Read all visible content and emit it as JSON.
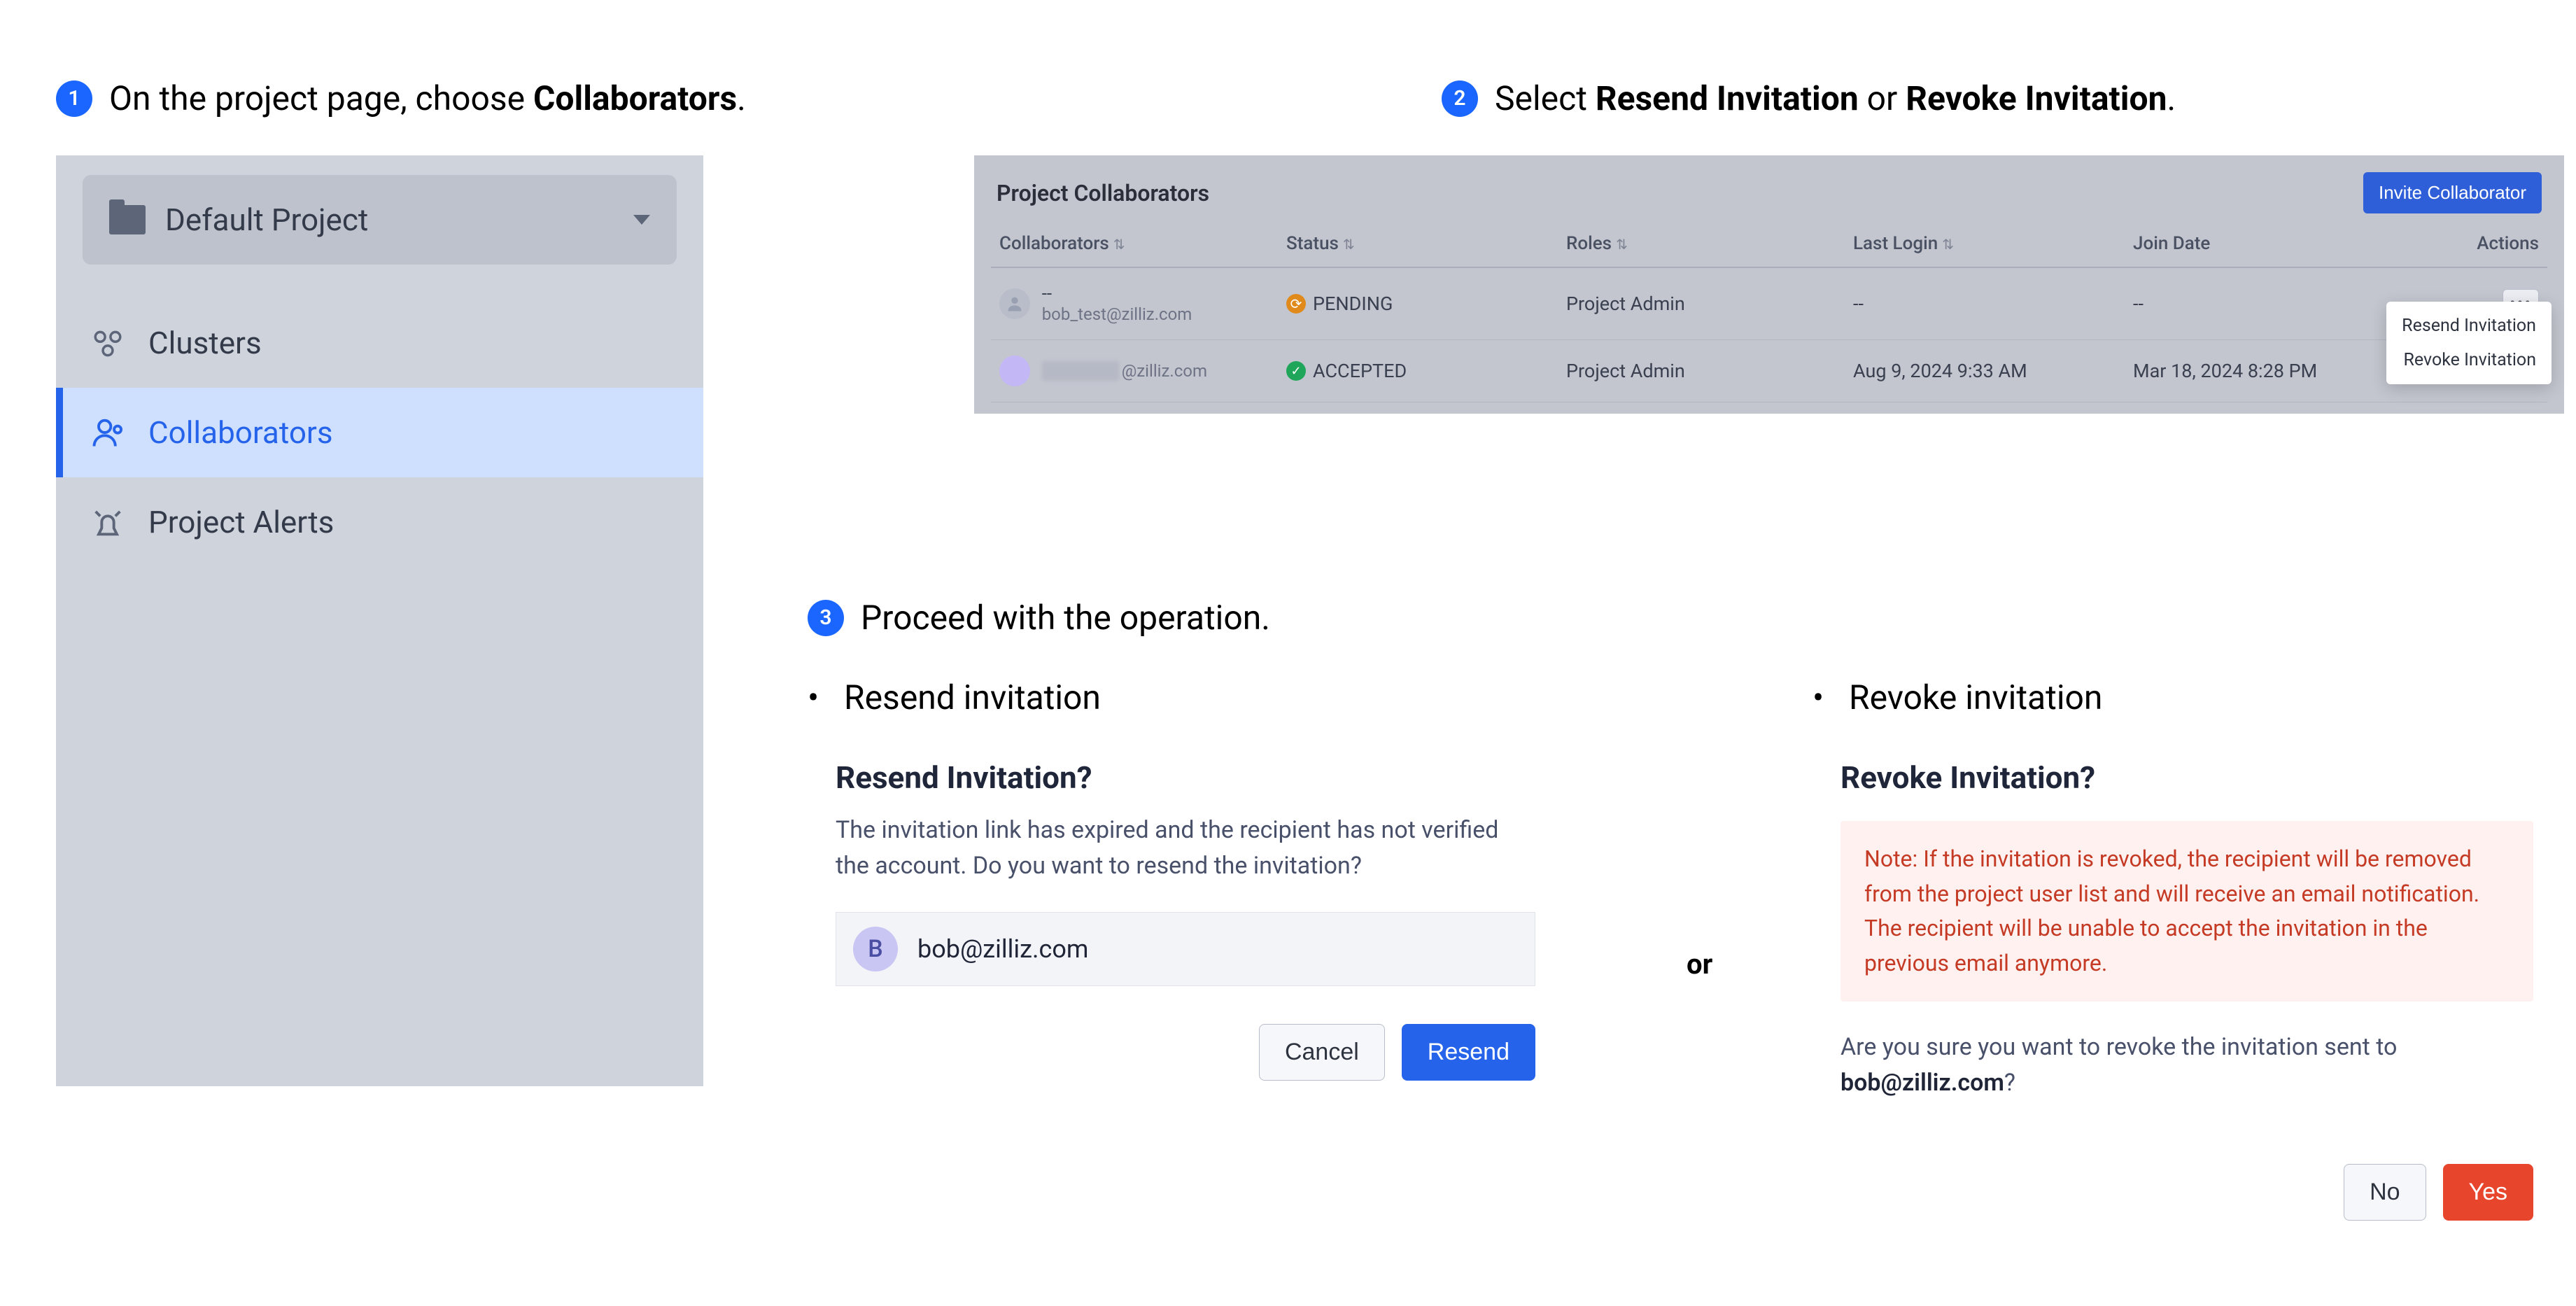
{
  "step1": {
    "text_pre": "On the project page, choose ",
    "text_bold": "Collaborators",
    "text_post": "."
  },
  "step2": {
    "text_pre": "Select ",
    "text_bold1": "Resend Invitation",
    "text_mid": " or ",
    "text_bold2": "Revoke Invitation",
    "text_post": "."
  },
  "step3": {
    "text": "Proceed with the operation."
  },
  "badge": {
    "n1": "1",
    "n2": "2",
    "n3": "3"
  },
  "sidebar": {
    "project_name": "Default Project",
    "items": {
      "clusters": "Clusters",
      "collaborators": "Collaborators",
      "alerts": "Project Alerts"
    }
  },
  "panel": {
    "title": "Project Collaborators",
    "invite_btn": "Invite Collaborator",
    "headers": {
      "collaborators": "Collaborators",
      "status": "Status",
      "roles": "Roles",
      "last_login": "Last Login",
      "join_date": "Join Date",
      "actions": "Actions"
    },
    "row1": {
      "name_top": "--",
      "name_bottom": "bob_test@zilliz.com",
      "status": "PENDING",
      "role": "Project Admin",
      "last_login": "--",
      "join_date": "--"
    },
    "row2": {
      "name_suffix": "@zilliz.com",
      "status": "ACCEPTED",
      "role": "Project Admin",
      "last_login": "Aug 9, 2024 9:33 AM",
      "join_date": "Mar 18, 2024 8:28 PM"
    },
    "menu": {
      "resend": "Resend Invitation",
      "revoke": "Revoke Invitation"
    }
  },
  "resend": {
    "bullet": "Resend invitation",
    "title": "Resend Invitation?",
    "body": "The invitation link has expired and the recipient has not verified the account. Do you want to resend the invitation?",
    "avatar_letter": "B",
    "email": "bob@zilliz.com",
    "cancel": "Cancel",
    "confirm": "Resend"
  },
  "or_label": "or",
  "revoke": {
    "bullet": "Revoke invitation",
    "title": "Revoke Invitation?",
    "warn": "Note: If the invitation is revoked, the recipient will be removed from the project user list and will receive an email notification. The recipient will be unable to accept the invitation in the previous email anymore.",
    "confirm_q_pre": "Are you sure you want to revoke the invitation sent to ",
    "confirm_q_email": "bob@zilliz.com",
    "confirm_q_post": "?",
    "no": "No",
    "yes": "Yes"
  }
}
